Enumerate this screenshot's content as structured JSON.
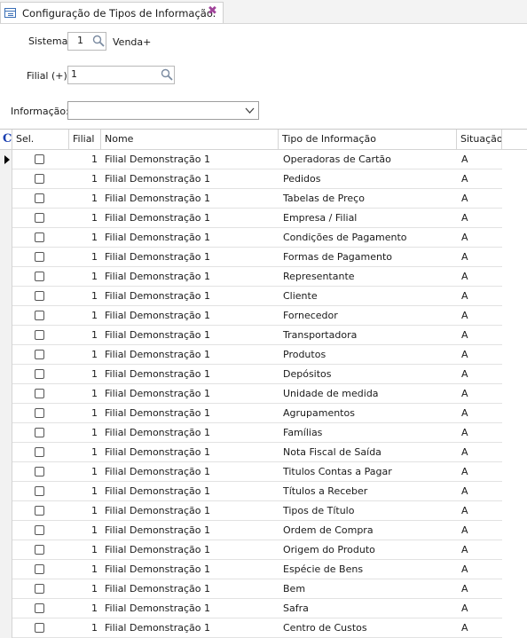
{
  "tab": {
    "title": "Configuração de  Tipos de Informação.",
    "close_glyph": "✖"
  },
  "form": {
    "sistema_label": "Sistema:",
    "sistema_value": "1",
    "sistema_desc": "Venda+",
    "filial_label": "Filial (+):",
    "filial_value": "1",
    "informacao_label": "Informação:",
    "informacao_value": ""
  },
  "grid": {
    "columns": [
      "C",
      "Sel.",
      "Filial",
      "Nome",
      "Tipo de Informação",
      "Situação"
    ],
    "rows": [
      {
        "filial": "1",
        "nome": "Filial Demonstração 1",
        "tipo": "Operadoras de Cartão",
        "situacao": "A"
      },
      {
        "filial": "1",
        "nome": "Filial Demonstração 1",
        "tipo": "Pedidos",
        "situacao": "A"
      },
      {
        "filial": "1",
        "nome": "Filial Demonstração 1",
        "tipo": "Tabelas de Preço",
        "situacao": "A"
      },
      {
        "filial": "1",
        "nome": "Filial Demonstração 1",
        "tipo": "Empresa / Filial",
        "situacao": "A"
      },
      {
        "filial": "1",
        "nome": "Filial Demonstração 1",
        "tipo": "Condições de Pagamento",
        "situacao": "A"
      },
      {
        "filial": "1",
        "nome": "Filial Demonstração 1",
        "tipo": "Formas de Pagamento",
        "situacao": "A"
      },
      {
        "filial": "1",
        "nome": "Filial Demonstração 1",
        "tipo": "Representante",
        "situacao": "A"
      },
      {
        "filial": "1",
        "nome": "Filial Demonstração 1",
        "tipo": "Cliente",
        "situacao": "A"
      },
      {
        "filial": "1",
        "nome": "Filial Demonstração 1",
        "tipo": "Fornecedor",
        "situacao": "A"
      },
      {
        "filial": "1",
        "nome": "Filial Demonstração 1",
        "tipo": "Transportadora",
        "situacao": "A"
      },
      {
        "filial": "1",
        "nome": "Filial Demonstração 1",
        "tipo": "Produtos",
        "situacao": "A"
      },
      {
        "filial": "1",
        "nome": "Filial Demonstração 1",
        "tipo": "Depósitos",
        "situacao": "A"
      },
      {
        "filial": "1",
        "nome": "Filial Demonstração 1",
        "tipo": "Unidade de medida",
        "situacao": "A"
      },
      {
        "filial": "1",
        "nome": "Filial Demonstração 1",
        "tipo": "Agrupamentos",
        "situacao": "A"
      },
      {
        "filial": "1",
        "nome": "Filial Demonstração 1",
        "tipo": "Famílias",
        "situacao": "A"
      },
      {
        "filial": "1",
        "nome": "Filial Demonstração 1",
        "tipo": "Nota Fiscal de Saída",
        "situacao": "A"
      },
      {
        "filial": "1",
        "nome": "Filial Demonstração 1",
        "tipo": "Titulos Contas a Pagar",
        "situacao": "A"
      },
      {
        "filial": "1",
        "nome": "Filial Demonstração 1",
        "tipo": "Títulos a Receber",
        "situacao": "A"
      },
      {
        "filial": "1",
        "nome": "Filial Demonstração 1",
        "tipo": "Tipos de Título",
        "situacao": "A"
      },
      {
        "filial": "1",
        "nome": "Filial Demonstração 1",
        "tipo": "Ordem de Compra",
        "situacao": "A"
      },
      {
        "filial": "1",
        "nome": "Filial Demonstração 1",
        "tipo": "Origem do Produto",
        "situacao": "A"
      },
      {
        "filial": "1",
        "nome": "Filial Demonstração 1",
        "tipo": "Espécie de Bens",
        "situacao": "A"
      },
      {
        "filial": "1",
        "nome": "Filial Demonstração 1",
        "tipo": "Bem",
        "situacao": "A"
      },
      {
        "filial": "1",
        "nome": "Filial Demonstração 1",
        "tipo": "Safra",
        "situacao": "A"
      },
      {
        "filial": "1",
        "nome": "Filial Demonstração 1",
        "tipo": "Centro de Custos",
        "situacao": "A"
      }
    ]
  }
}
